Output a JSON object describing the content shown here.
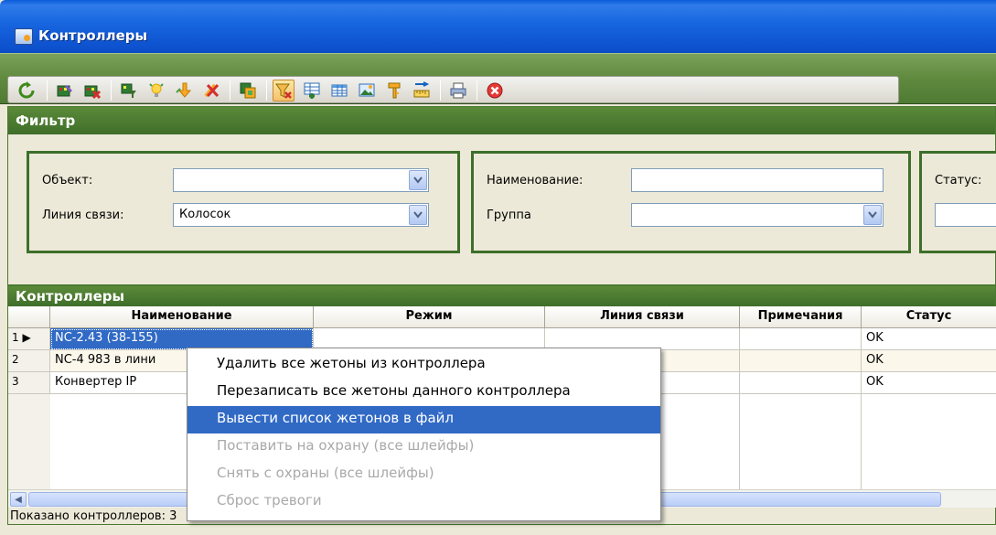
{
  "window": {
    "title": "Контроллеры"
  },
  "toolbar": {
    "buttons": [
      {
        "icon": "refresh-icon"
      },
      {
        "icon": "edit-controller-icon"
      },
      {
        "icon": "delete-controller-icon"
      },
      {
        "icon": "filter-controller-icon"
      },
      {
        "icon": "bulb-icon"
      },
      {
        "icon": "arrow-down-icon"
      },
      {
        "icon": "cancel-tools-icon"
      },
      {
        "icon": "export-icon"
      },
      {
        "icon": "filter-icon",
        "active": true
      },
      {
        "icon": "add-row-icon"
      },
      {
        "icon": "table-icon"
      },
      {
        "icon": "picture-icon"
      },
      {
        "icon": "key-icon"
      },
      {
        "icon": "ruler-icon"
      },
      {
        "icon": "print-icon"
      },
      {
        "icon": "close-icon"
      }
    ]
  },
  "filter": {
    "header": "Фильтр",
    "object_label": "Объект:",
    "object_value": "",
    "line_label": "Линия связи:",
    "line_value": "Колосок",
    "name_label": "Наименование:",
    "name_value": "",
    "group_label": "Группа",
    "group_value": "",
    "status_label": "Статус:"
  },
  "grid": {
    "header": "Контроллеры",
    "columns": [
      "Наименование",
      "Режим",
      "Линия связи",
      "Примечания",
      "Статус"
    ],
    "rows": [
      {
        "num": "1",
        "name": "NC-2.43 (38-155)",
        "mode": "",
        "line": "",
        "notes": "",
        "status": "OK"
      },
      {
        "num": "2",
        "name": "NC-4 983 в лини",
        "mode": "",
        "line": "",
        "notes": "",
        "status": "OK"
      },
      {
        "num": "3",
        "name": "Конвертер IP",
        "mode": "",
        "line": "",
        "notes": "",
        "status": "OK"
      }
    ],
    "status_text": "Показано контроллеров: 3"
  },
  "context_menu": {
    "items": [
      {
        "label": "Удалить все жетоны из контроллера",
        "state": "normal"
      },
      {
        "label": "Перезаписать все жетоны данного контроллера",
        "state": "normal"
      },
      {
        "label": "Вывести список жетонов в файл",
        "state": "highlighted"
      },
      {
        "label": "Поставить на охрану (все шлейфы)",
        "state": "disabled"
      },
      {
        "label": "Снять с охраны (все шлейфы)",
        "state": "disabled"
      },
      {
        "label": "Сброс тревоги",
        "state": "disabled"
      }
    ]
  },
  "colors": {
    "titlebar": "#1765DF",
    "section_header": "#4A7A2F",
    "selection": "#316AC5"
  }
}
